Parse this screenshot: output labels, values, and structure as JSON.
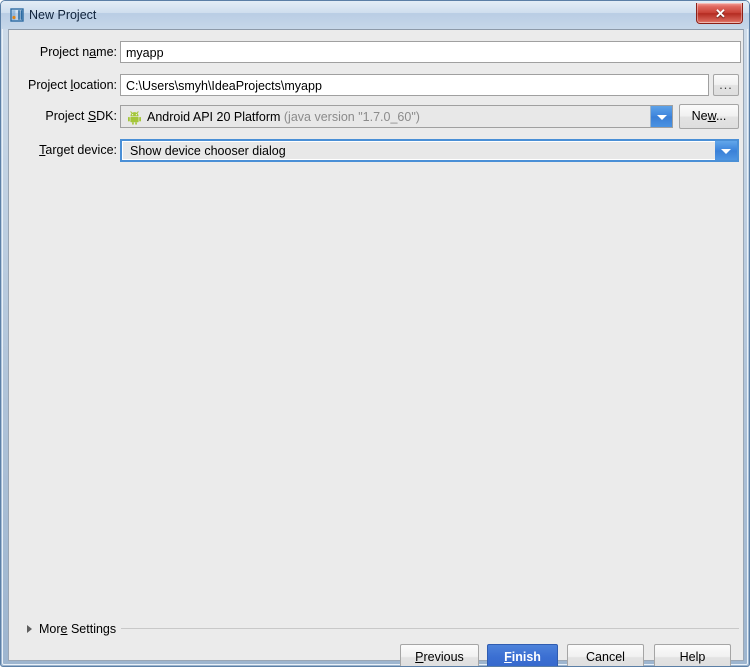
{
  "window": {
    "title": "New Project",
    "icon": "intellij-idea-icon",
    "close_label": "✕",
    "accent_blue": "#3b6fd2",
    "titlebar_color": "#cfdeee",
    "panel_color": "#ebebeb",
    "close_button_color": "#c73f34"
  },
  "form": {
    "project_name": {
      "label_pre": "Project n",
      "label_mnemonic": "a",
      "label_post": "me:",
      "value": "myapp",
      "placeholder": ""
    },
    "project_location": {
      "label_pre": "Project ",
      "label_mnemonic": "l",
      "label_post": "ocation:",
      "value": "C:\\Users\\smyh\\IdeaProjects\\myapp",
      "placeholder": "",
      "browse_label": "..."
    },
    "project_sdk": {
      "label_pre": "Project ",
      "label_mnemonic": "S",
      "label_post": "DK:",
      "icon": "android-robot-icon",
      "value": "Android API 20 Platform",
      "value_detail": "(java version \"1.7.0_60\")",
      "new_button_pre": "Ne",
      "new_button_mnemonic": "w",
      "new_button_post": "..."
    },
    "target_device": {
      "label_pre": "",
      "label_mnemonic": "T",
      "label_post": "arget device:",
      "value": "Show device chooser dialog"
    }
  },
  "more_settings": {
    "label_pre": "Mor",
    "label_mnemonic": "e",
    "label_post": " Settings",
    "expanded": "false"
  },
  "footer": {
    "previous": {
      "pre": "",
      "mnemonic": "P",
      "post": "revious"
    },
    "finish": {
      "pre": "",
      "mnemonic": "F",
      "post": "inish"
    },
    "cancel": {
      "pre": "Cancel",
      "mnemonic": "",
      "post": ""
    },
    "help": {
      "pre": "Help",
      "mnemonic": "",
      "post": ""
    }
  }
}
